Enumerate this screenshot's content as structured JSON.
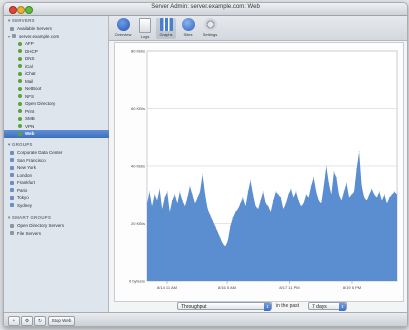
{
  "window": {
    "title": "Server Admin: server.example.com: Web"
  },
  "sidebar": {
    "servers_header": "▾ SERVERS",
    "available_servers": "Available Servers",
    "server_name": "server.example.com",
    "services": [
      "AFP",
      "DHCP",
      "DNS",
      "iCal",
      "iChat",
      "Mail",
      "NetBoot",
      "NFS",
      "Open Directory",
      "Print",
      "SMB",
      "VPN",
      "Web"
    ],
    "selected_service": "Web",
    "groups_header": "▾ GROUPS",
    "groups": [
      "Corporate Data Center",
      "San Francisco",
      "New York",
      "London",
      "Frankfurt",
      "Paris",
      "Tokyo",
      "Sydney"
    ],
    "smart_groups_header": "▾ SMART GROUPS",
    "smart_groups": [
      "Open Directory Servers",
      "File Servers"
    ]
  },
  "bottombar": {
    "add": "+",
    "gear": "⚙",
    "refresh": "↻",
    "stop_label": "Stop Web"
  },
  "toolbar": {
    "items": [
      {
        "label": "Overview",
        "icon": "info-icon"
      },
      {
        "label": "Logs",
        "icon": "logs-icon"
      },
      {
        "label": "Graphs",
        "icon": "graphs-icon"
      },
      {
        "label": "Sites",
        "icon": "sites-icon"
      },
      {
        "label": "Settings",
        "icon": "settings-icon"
      }
    ],
    "active": "Graphs"
  },
  "graph": {
    "y_labels": [
      "80 KB/s",
      "60 KB/s",
      "40 KB/s",
      "20 KB/s",
      "0 bytes/s"
    ],
    "x_labels": [
      "8/14 11 AM",
      "8/16 5 AM",
      "8/17 11 PM",
      "8/19 5 PM"
    ],
    "fill_color": "#5b8ed1"
  },
  "chart_data": {
    "type": "area",
    "title": "",
    "xlabel": "",
    "ylabel": "",
    "ylim": [
      0,
      80
    ],
    "y_unit": "KB/s",
    "x_range": [
      "8/13",
      "8/20"
    ],
    "x_ticks": [
      "8/14 11 AM",
      "8/16 5 AM",
      "8/17 11 PM",
      "8/19 5 PM"
    ],
    "series": [
      {
        "values": [
          27,
          31,
          26,
          30,
          28,
          32,
          25,
          29,
          31,
          24,
          28,
          30,
          27,
          31,
          28,
          26,
          29,
          33,
          30,
          27,
          29,
          31,
          37,
          30,
          25,
          23,
          21,
          19,
          17,
          15,
          13,
          12,
          14,
          19,
          22,
          24,
          25,
          27,
          29,
          26,
          31,
          35,
          30,
          26,
          25,
          28,
          31,
          27,
          26,
          24,
          28,
          31,
          30,
          29,
          25,
          27,
          30,
          32,
          29,
          31,
          28,
          26,
          27,
          30,
          29,
          33,
          36,
          31,
          28,
          27,
          33,
          40,
          34,
          30,
          38,
          36,
          30,
          28,
          31,
          34,
          29,
          30,
          31,
          39,
          45,
          33,
          29,
          28,
          30,
          32,
          30,
          29,
          31,
          28,
          30,
          27,
          29,
          30,
          31,
          30
        ]
      }
    ],
    "grid": true
  },
  "controls": {
    "metric": "Throughput",
    "in_the_past": "in the past",
    "period": "7 days"
  }
}
